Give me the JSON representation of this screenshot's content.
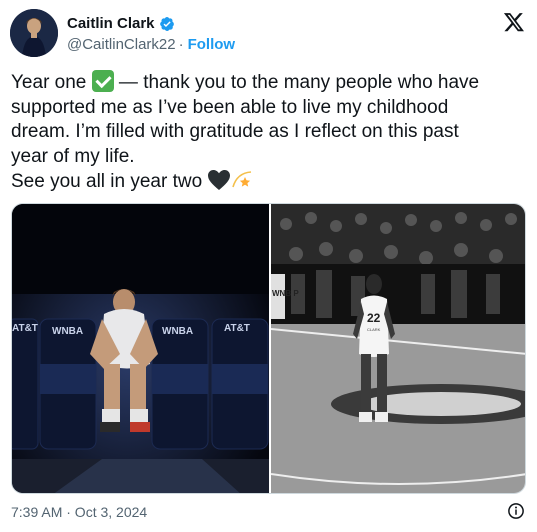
{
  "tweet": {
    "display_name": "Caitlin Clark",
    "handle": "@CaitlinClark22",
    "separator": "·",
    "follow_label": "Follow",
    "text_line1_a": "Year one ",
    "text_line1_b": " — thank you to the many people who have",
    "text_line2": "supported me as I’ve been able to live my childhood",
    "text_line3": "dream. I’m filled with gratitude as I reflect on this past",
    "text_line4": "year of my life.",
    "text_line5": "See you all in year two ",
    "timestamp": "7:39 AM · Oct 3, 2024"
  },
  "photos": {
    "left": {
      "banner_texts": [
        "AT&T",
        "WNBA",
        "WNBA",
        "AT&T"
      ]
    },
    "right": {
      "jersey_number": "22",
      "jersey_name": "CLARK",
      "sign_text": "WNB P"
    }
  },
  "icons": {
    "verified": "verified-badge-icon",
    "brand": "x-logo-icon",
    "info": "info-icon",
    "check_emoji": "check-mark-emoji",
    "heart_emoji": "black-heart-emoji",
    "star_emoji": "dizzy-star-emoji"
  },
  "colors": {
    "accent": "#1d9bf0",
    "text": "#0f1419",
    "muted": "#536471",
    "border": "#cfd9de"
  }
}
